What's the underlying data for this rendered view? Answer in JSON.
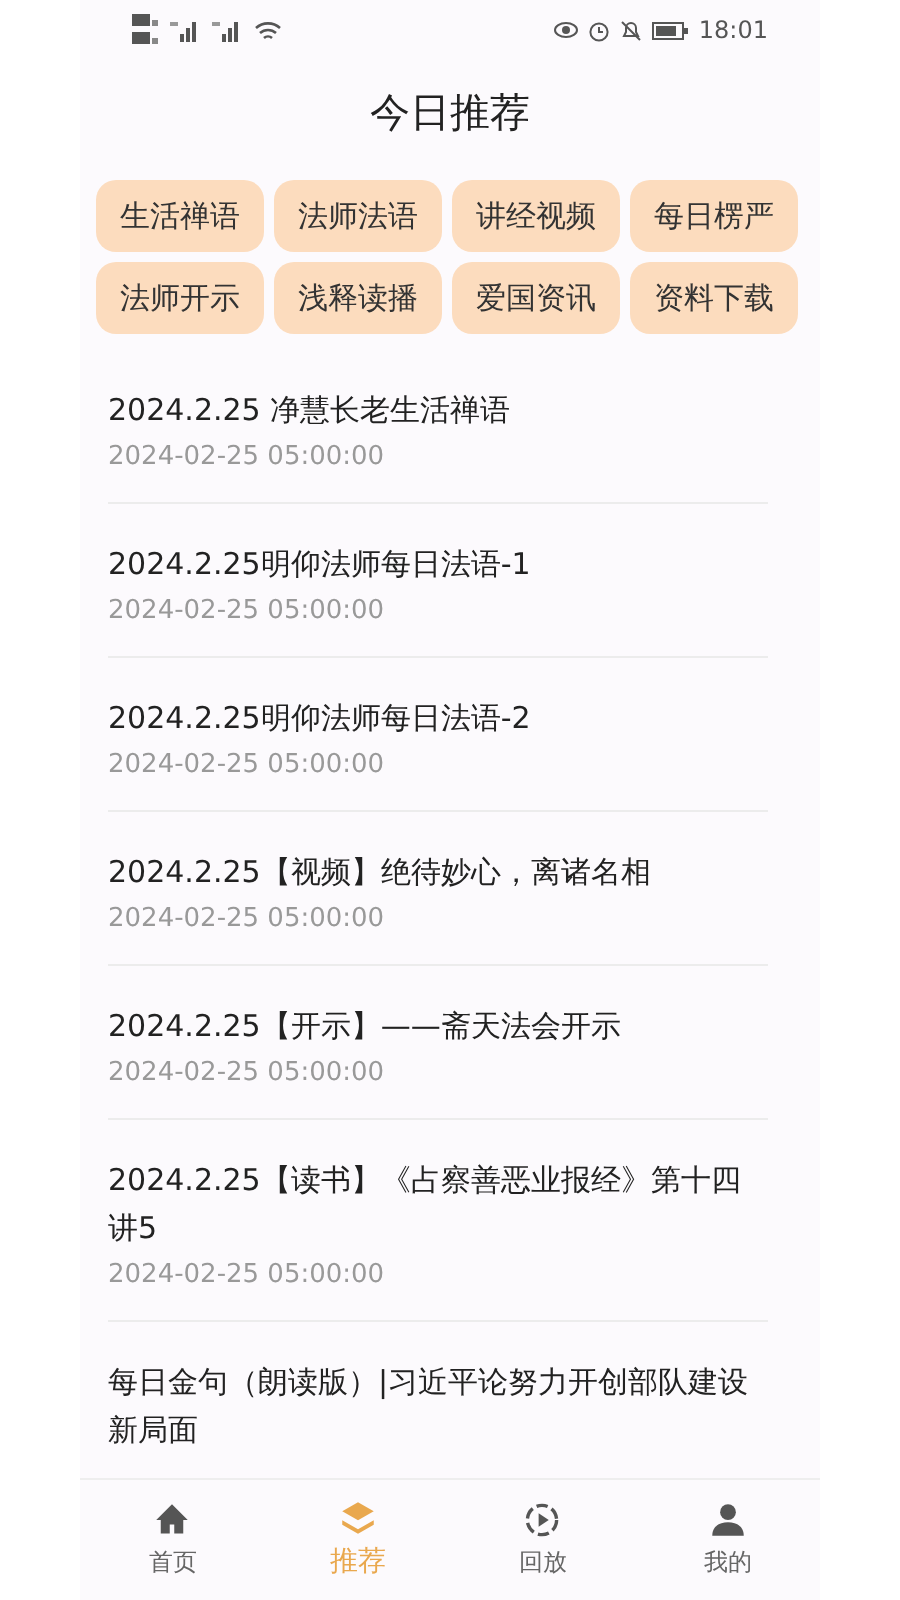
{
  "status_bar": {
    "time": "18:01"
  },
  "header": {
    "title": "今日推荐"
  },
  "categories": [
    {
      "label": "生活禅语"
    },
    {
      "label": "法师法语"
    },
    {
      "label": "讲经视频"
    },
    {
      "label": "每日楞严"
    },
    {
      "label": "法师开示"
    },
    {
      "label": "浅释读播"
    },
    {
      "label": "爱国资讯"
    },
    {
      "label": "资料下载"
    }
  ],
  "articles": [
    {
      "title": "2024.2.25 净慧长老生活禅语",
      "date": "2024-02-25 05:00:00"
    },
    {
      "title": "2024.2.25明仰法师每日法语-1",
      "date": "2024-02-25 05:00:00"
    },
    {
      "title": "2024.2.25明仰法师每日法语-2",
      "date": "2024-02-25 05:00:00"
    },
    {
      "title": "2024.2.25【视频】绝待妙心，离诸名相",
      "date": "2024-02-25 05:00:00"
    },
    {
      "title": "2024.2.25【开示】——斋天法会开示",
      "date": "2024-02-25 05:00:00"
    },
    {
      "title": "2024.2.25【读书】《占察善恶业报经》第十四讲5",
      "date": "2024-02-25 05:00:00"
    },
    {
      "title": "每日金句（朗读版）|习近平论努力开创部队建设新局面"
    }
  ],
  "tab_bar": [
    {
      "label": "首页",
      "kind": "home",
      "selected": false
    },
    {
      "label": "推荐",
      "kind": "layers",
      "selected": true
    },
    {
      "label": "回放",
      "kind": "replay",
      "selected": false
    },
    {
      "label": "我的",
      "kind": "user",
      "selected": false
    }
  ]
}
